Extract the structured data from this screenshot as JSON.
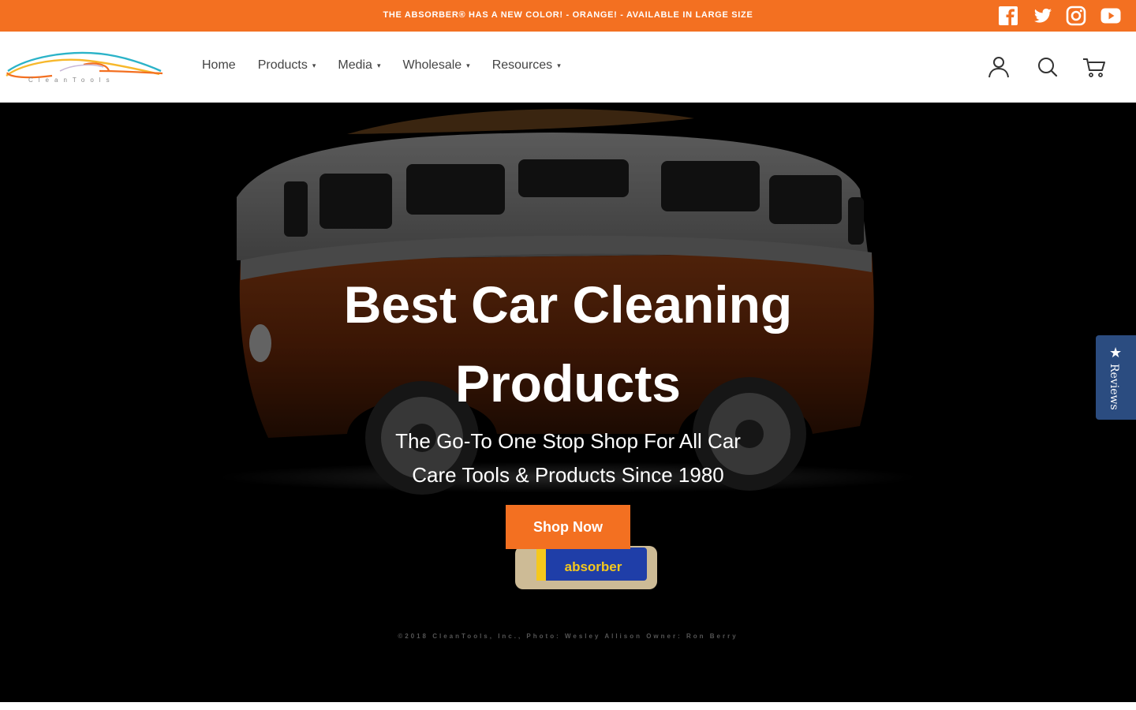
{
  "announcement": {
    "text": "THE ABSORBER® HAS A NEW COLOR! - ORANGE! - AVAILABLE IN LARGE SIZE"
  },
  "social": [
    "facebook-icon",
    "twitter-icon",
    "instagram-icon",
    "youtube-icon"
  ],
  "logo": {
    "text": "CleanTools"
  },
  "nav": {
    "items": [
      {
        "label": "Home",
        "dropdown": false
      },
      {
        "label": "Products",
        "dropdown": true
      },
      {
        "label": "Media",
        "dropdown": true
      },
      {
        "label": "Wholesale",
        "dropdown": true
      },
      {
        "label": "Resources",
        "dropdown": true
      }
    ],
    "caret": "▾"
  },
  "header_icons": [
    "account-icon",
    "search-icon",
    "cart-icon"
  ],
  "hero": {
    "title": "Best Car Cleaning Products",
    "subtitle": "The Go-To One Stop Shop For All Car Care Tools & Products Since 1980",
    "cta": "Shop Now",
    "product_label": "absorber",
    "copyright": "©2018 CleanTools, Inc., Photo: Wesley Allison   Owner: Ron Berry"
  },
  "reviews_tab": {
    "label": "Reviews",
    "icon": "star-icon"
  },
  "colors": {
    "accent": "#f37021",
    "reviews": "#2b4c80",
    "hero_bg": "#000000"
  }
}
